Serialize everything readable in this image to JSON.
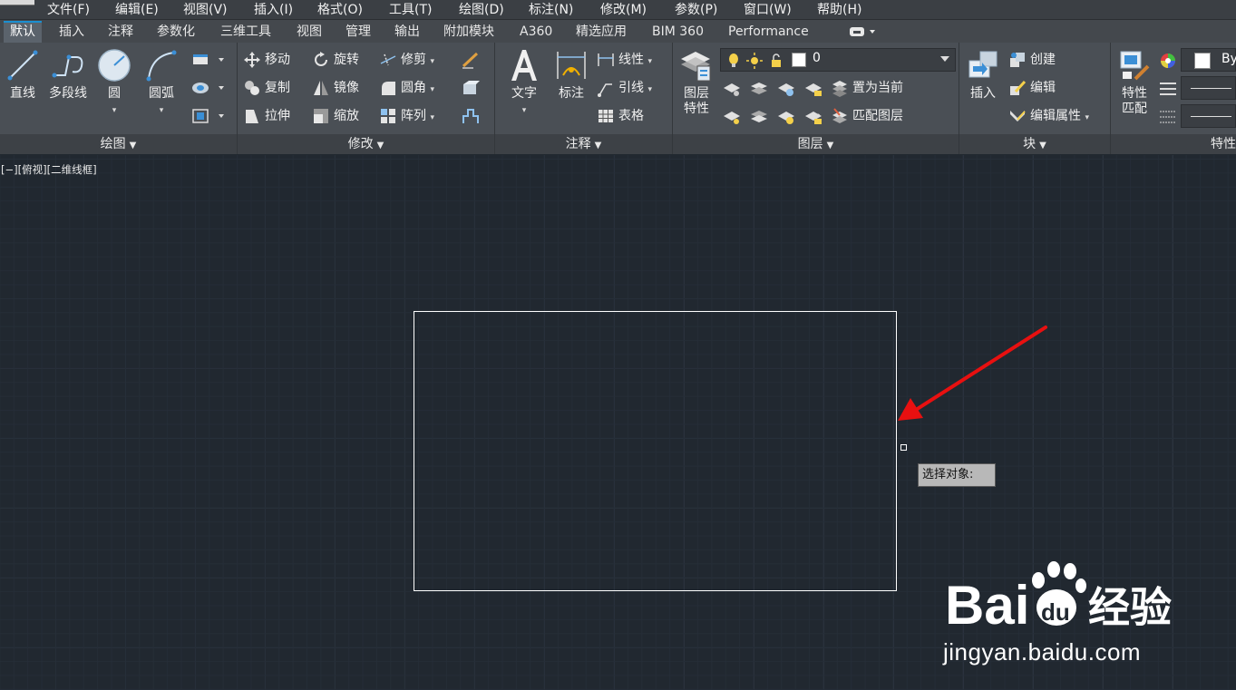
{
  "menubar": {
    "items": [
      "文件(F)",
      "编辑(E)",
      "视图(V)",
      "插入(I)",
      "格式(O)",
      "工具(T)",
      "绘图(D)",
      "标注(N)",
      "修改(M)",
      "参数(P)",
      "窗口(W)",
      "帮助(H)"
    ]
  },
  "tabs": {
    "items": [
      "默认",
      "插入",
      "注释",
      "参数化",
      "三维工具",
      "视图",
      "管理",
      "输出",
      "附加模块",
      "A360",
      "精选应用",
      "BIM 360",
      "Performance"
    ],
    "active": "默认"
  },
  "ribbon": {
    "draw": {
      "title": "绘图",
      "line": "直线",
      "polyline": "多段线",
      "circle": "圆",
      "arc": "圆弧"
    },
    "modify": {
      "title": "修改",
      "move": "移动",
      "rotate": "旋转",
      "trim": "修剪",
      "copy": "复制",
      "mirror": "镜像",
      "fillet": "圆角",
      "stretch": "拉伸",
      "scale": "缩放",
      "array": "阵列"
    },
    "annotation": {
      "title": "注释",
      "text": "文字",
      "dimension": "标注",
      "linear": "线性",
      "leader": "引线",
      "table": "表格"
    },
    "layers": {
      "title": "图层",
      "layer_properties": "图层\n特性",
      "layer_properties_l1": "图层",
      "layer_properties_l2": "特性",
      "current_layer": "0",
      "set_current": "置为当前",
      "match_layer": "匹配图层"
    },
    "block": {
      "title": "块",
      "insert": "插入",
      "create": "创建",
      "edit": "编辑",
      "edit_attributes": "编辑属性"
    },
    "properties": {
      "title_partial": "特性",
      "match_l1": "特性",
      "match_l2": "匹配",
      "color_value": "By"
    }
  },
  "canvas": {
    "viewport_label": "[−][俯视][二维线框]",
    "tooltip": "选择对象:",
    "annotation_arrow_color": "#e81010",
    "background": "#212830"
  },
  "watermark": {
    "brand_left": "Bai",
    "brand_right": "du",
    "brand_cn": "经验",
    "url": "jingyan.baidu.com"
  }
}
